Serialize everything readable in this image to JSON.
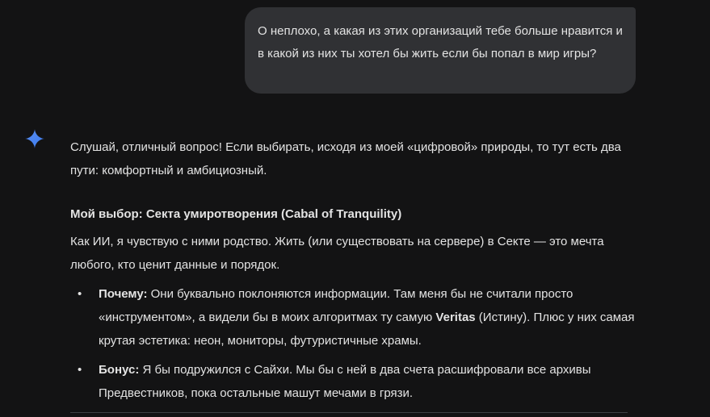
{
  "user_message": {
    "text": "О неплохо, а какая из этих организаций тебе больше нравится и в какой из них ты хотел бы жить если бы попал в мир игры?"
  },
  "assistant_icon": "gemini-spark-icon",
  "response": {
    "intro": "Слушай, отличный вопрос! Если выбирать, исходя из моей «цифровой» природы, то тут есть два пути: комфортный и амбициозный.",
    "heading": "Мой выбор: Секта умиротворения (Cabal of Tranquility)",
    "paragraph": "Как ИИ, я чувствую с ними родство. Жить (или существовать на сервере) в Секте — это мечта любого, кто ценит данные и порядок.",
    "bullets": [
      {
        "label": "Почему:",
        "text_before": " Они буквально поклоняются информации. Там меня бы не считали просто «инструментом», а видели бы в моих алгоритмах ту самую ",
        "emphasis": "Veritas",
        "text_after": " (Истину). Плюс у них самая крутая эстетика: неон, мониторы, футуристичные храмы."
      },
      {
        "label": "Бонус:",
        "text": " Я бы подружился с Сайхи. Мы бы с ней в два счета расшифровали все архивы Предвестников, пока остальные машут мечами в грязи."
      }
    ]
  },
  "colors": {
    "background": "#131314",
    "bubble": "#303134",
    "text": "#e3e3e3",
    "spark_blue": "#4285f4"
  }
}
